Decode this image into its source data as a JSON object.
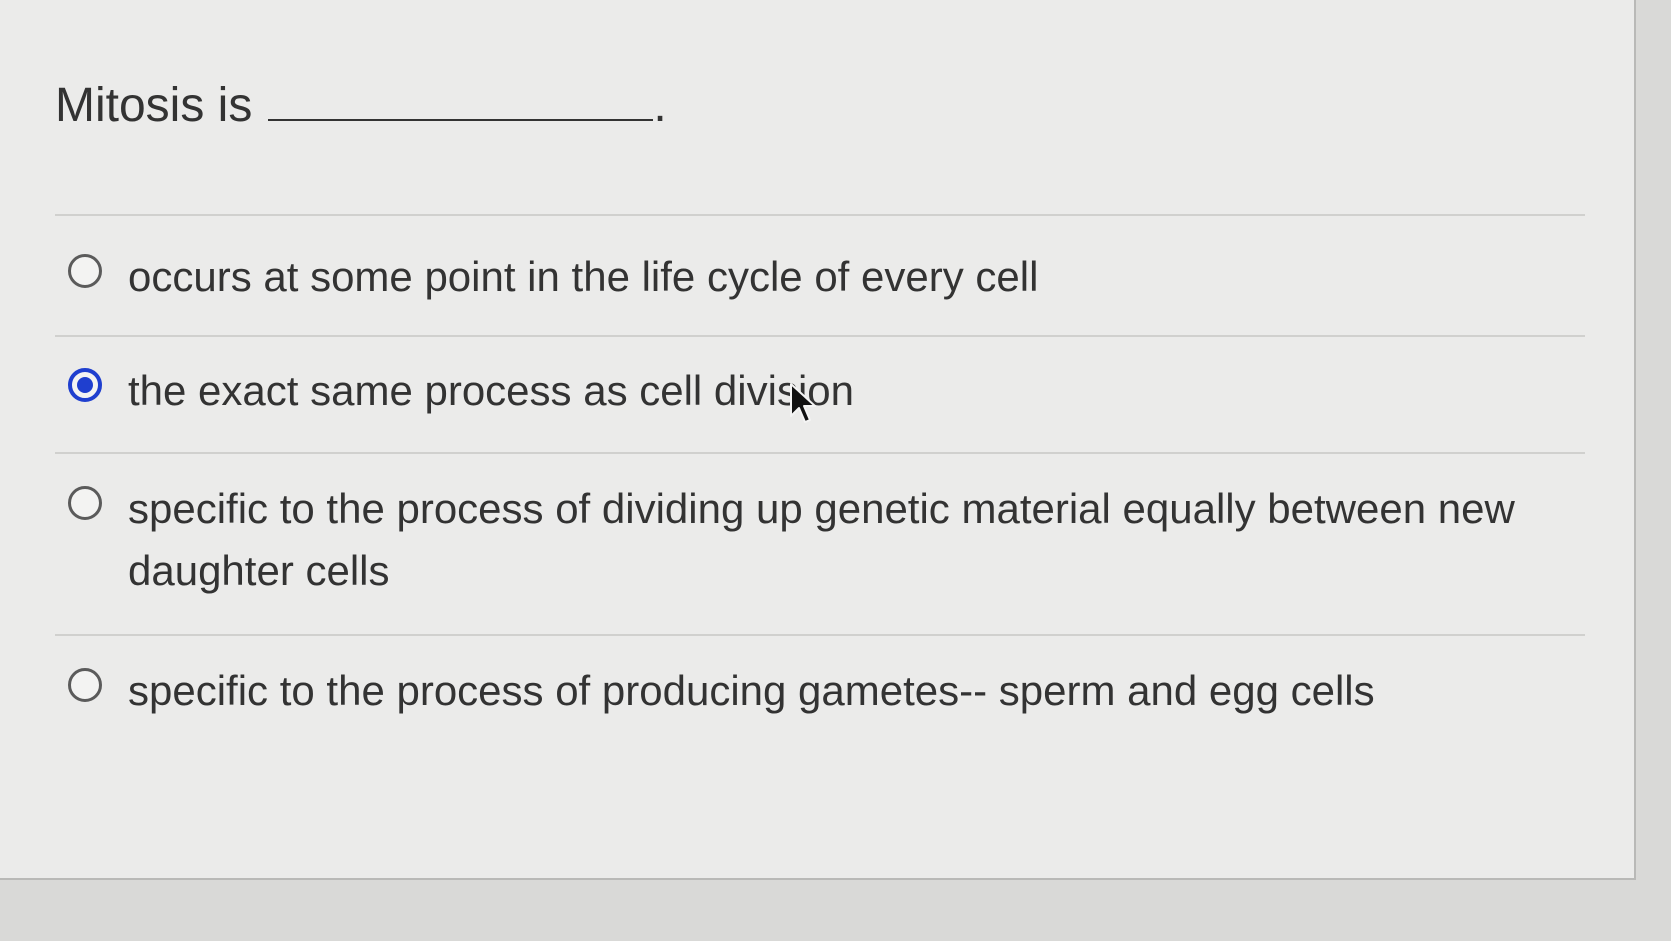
{
  "question": {
    "prefix": "Mitosis is",
    "suffix": "."
  },
  "options": [
    {
      "label": "occurs at some point in the life cycle of every cell",
      "selected": false
    },
    {
      "label": "the exact same process as cell division",
      "selected": true
    },
    {
      "label": "specific to the process of dividing up genetic material equally between new daughter cells",
      "selected": false
    },
    {
      "label": "specific to the process of producing gametes-- sperm and egg cells",
      "selected": false
    }
  ],
  "colors": {
    "accent": "#1f3fcf",
    "text": "#333333",
    "background": "#ebebea"
  },
  "icons": {
    "cursor": "mouse-pointer-icon"
  }
}
